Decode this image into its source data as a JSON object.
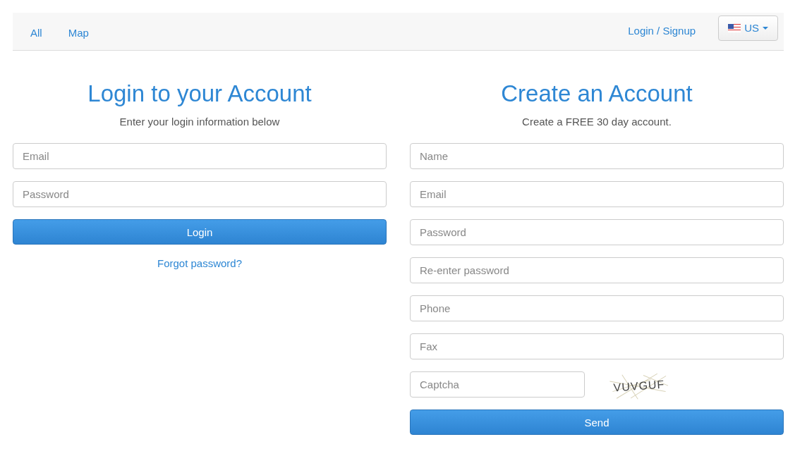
{
  "navbar": {
    "links": [
      {
        "label": "All"
      },
      {
        "label": "Map"
      }
    ],
    "account_link": "Login / Signup",
    "language": {
      "label": "US"
    }
  },
  "login": {
    "title": "Login to your Account",
    "subtitle": "Enter your login information below",
    "fields": [
      {
        "placeholder": "Email"
      },
      {
        "placeholder": "Password"
      }
    ],
    "button": "Login",
    "forgot_link": "Forgot password?"
  },
  "signup": {
    "title": "Create an Account",
    "subtitle": "Create a FREE 30 day account.",
    "fields": [
      {
        "placeholder": "Name"
      },
      {
        "placeholder": "Email"
      },
      {
        "placeholder": "Password"
      },
      {
        "placeholder": "Re-enter password"
      },
      {
        "placeholder": "Phone"
      },
      {
        "placeholder": "Fax"
      }
    ],
    "captcha": {
      "placeholder": "Captcha",
      "code": "VUVGUF"
    },
    "button": "Send"
  }
}
